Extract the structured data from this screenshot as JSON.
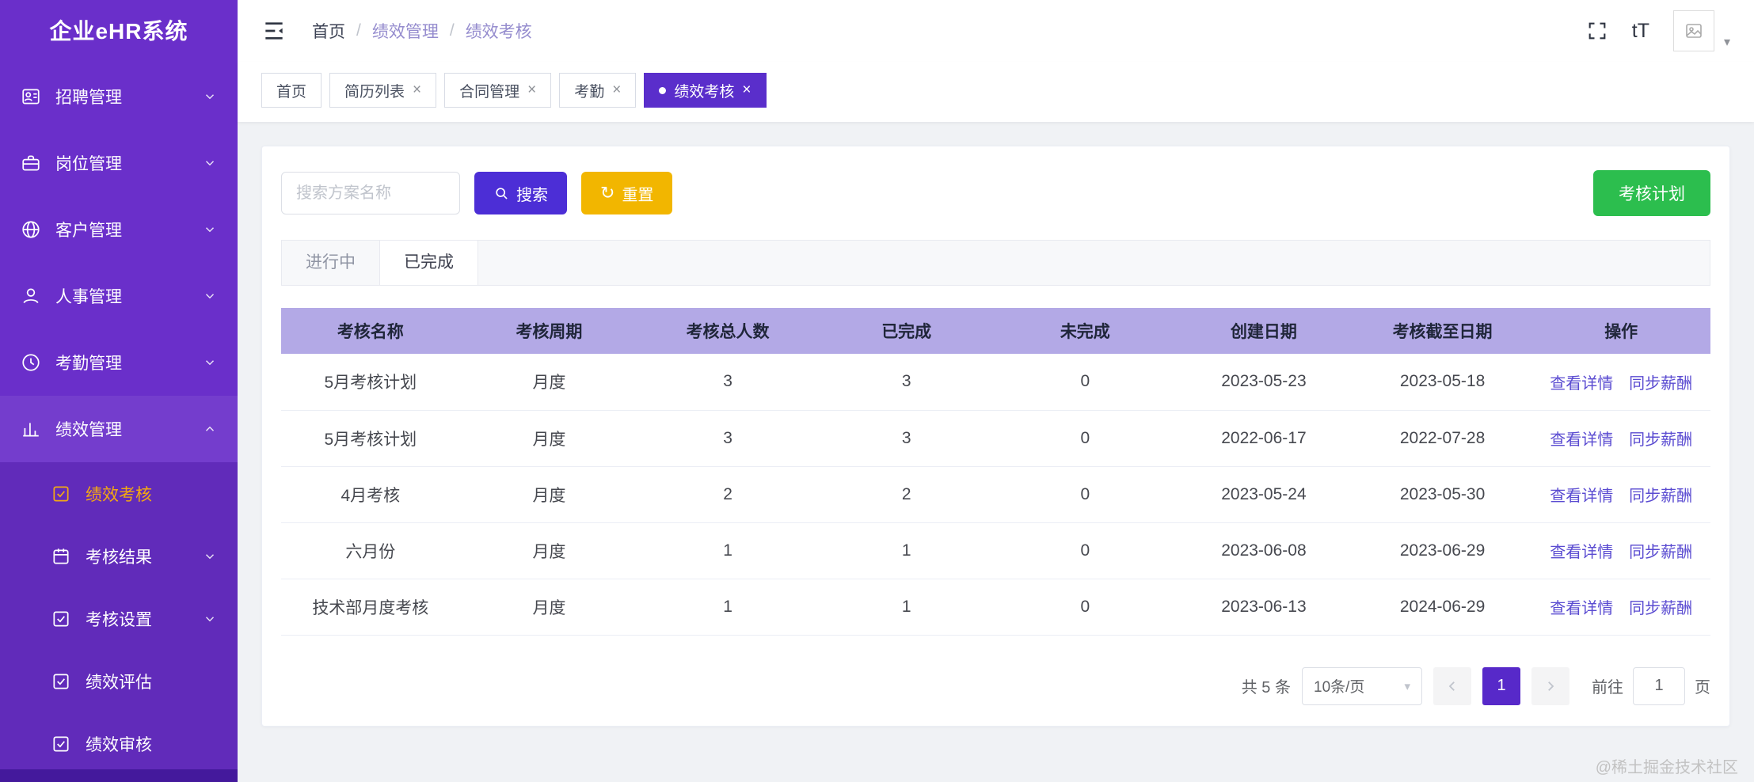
{
  "app": {
    "title": "企业eHR系统"
  },
  "sidebar": {
    "items": [
      {
        "label": "招聘管理"
      },
      {
        "label": "岗位管理"
      },
      {
        "label": "客户管理"
      },
      {
        "label": "人事管理"
      },
      {
        "label": "考勤管理"
      },
      {
        "label": "绩效管理"
      }
    ],
    "submenu": [
      {
        "label": "绩效考核"
      },
      {
        "label": "考核结果"
      },
      {
        "label": "考核设置"
      },
      {
        "label": "绩效评估"
      },
      {
        "label": "绩效审核"
      }
    ]
  },
  "header": {
    "breadcrumb": [
      "首页",
      "绩效管理",
      "绩效考核"
    ],
    "separator": "/",
    "font_size_label": "tT"
  },
  "tabs": [
    {
      "label": "首页"
    },
    {
      "label": "简历列表"
    },
    {
      "label": "合同管理"
    },
    {
      "label": "考勤"
    },
    {
      "label": "绩效考核"
    }
  ],
  "toolbar": {
    "search_placeholder": "搜索方案名称",
    "search_label": "搜索",
    "reset_label": "重置",
    "plan_label": "考核计划"
  },
  "content_tabs": [
    {
      "label": "进行中"
    },
    {
      "label": "已完成"
    }
  ],
  "table": {
    "headers": [
      "考核名称",
      "考核周期",
      "考核总人数",
      "已完成",
      "未完成",
      "创建日期",
      "考核截至日期",
      "操作"
    ],
    "actions": [
      "查看详情",
      "同步薪酬"
    ],
    "rows": [
      {
        "name": "5月考核计划",
        "period": "月度",
        "total": 3,
        "done": 3,
        "undone": 0,
        "created": "2023-05-23",
        "deadline": "2023-05-18"
      },
      {
        "name": "5月考核计划",
        "period": "月度",
        "total": 3,
        "done": 3,
        "undone": 0,
        "created": "2022-06-17",
        "deadline": "2022-07-28"
      },
      {
        "name": "4月考核",
        "period": "月度",
        "total": 2,
        "done": 2,
        "undone": 0,
        "created": "2023-05-24",
        "deadline": "2023-05-30"
      },
      {
        "name": "六月份",
        "period": "月度",
        "total": 1,
        "done": 1,
        "undone": 0,
        "created": "2023-06-08",
        "deadline": "2023-06-29"
      },
      {
        "name": "技术部月度考核",
        "period": "月度",
        "total": 1,
        "done": 1,
        "undone": 0,
        "created": "2023-06-13",
        "deadline": "2024-06-29"
      }
    ]
  },
  "pagination": {
    "total": "共 5 条",
    "page_size": "10条/页",
    "current": "1",
    "goto_prefix": "前往",
    "goto_value": "1",
    "goto_suffix": "页"
  },
  "footer": {
    "watermark": "@稀土掘金技术社区"
  }
}
